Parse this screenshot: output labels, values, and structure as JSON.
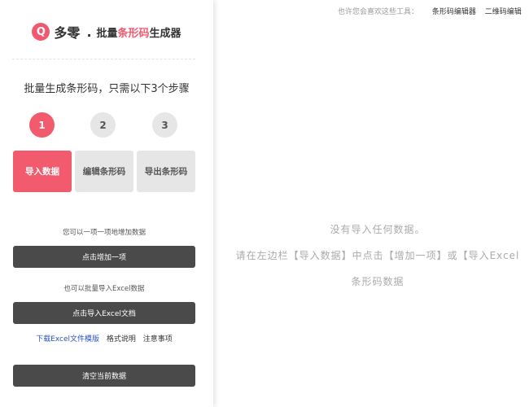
{
  "brand": {
    "logo_letter": "Q",
    "name": "多零",
    "dot": ".",
    "title_prefix": "批量",
    "title_highlight": "条形码",
    "title_suffix": "生成器"
  },
  "steps": {
    "title": "批量生成条形码，只需以下3个步骤",
    "numbers": [
      "1",
      "2",
      "3"
    ],
    "tabs": [
      "导入数据",
      "编辑条形码",
      "导出条形码"
    ]
  },
  "import": {
    "hint_single": "您可以一项一项地增加数据",
    "add_button": "点击增加一项",
    "hint_batch": "也可以批量导入Excel数据",
    "import_button": "点击导入Excel文档",
    "link_template": "下载Excel文件模版",
    "link_format": "格式说明",
    "link_notes": "注意事项",
    "clear_button": "清空当前数据"
  },
  "topbar": {
    "lead": "也许您会喜欢这些工具：",
    "tool1": "条形码编辑器",
    "tool2": "二维码编辑"
  },
  "empty_state": {
    "line1": "没有导入任何数据。",
    "line2": "请在左边栏【导入数据】中点击【增加一项】或【导入Excel",
    "line3": "条形码数据"
  },
  "colors": {
    "accent": "#f25a6e",
    "dark_button": "#4a4a4a",
    "inactive": "#e6e6e6"
  }
}
